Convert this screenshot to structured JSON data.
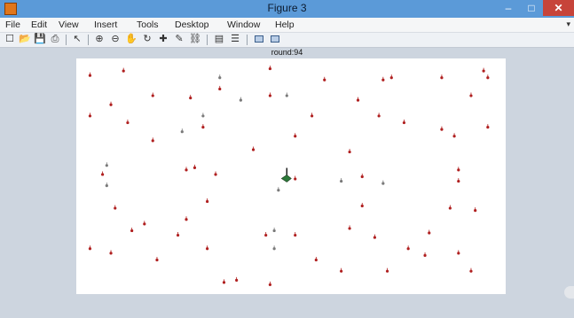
{
  "window": {
    "title": "Figure 3",
    "minimize_glyph": "–",
    "maximize_glyph": "□",
    "close_glyph": "✕"
  },
  "menu": {
    "items": [
      "File",
      "Edit",
      "View",
      "Insert",
      "Tools",
      "Desktop",
      "Window",
      "Help"
    ],
    "overflow_glyph": "▾"
  },
  "toolbar": {
    "buttons": [
      {
        "name": "new-figure-icon",
        "glyph": "☐"
      },
      {
        "name": "open-file-icon",
        "glyph": "📂"
      },
      {
        "name": "save-icon",
        "glyph": "💾"
      },
      {
        "name": "print-icon",
        "glyph": "⎙"
      },
      {
        "name": "pointer-icon",
        "glyph": "↖"
      },
      {
        "name": "zoom-in-icon",
        "glyph": "⊕"
      },
      {
        "name": "zoom-out-icon",
        "glyph": "⊖"
      },
      {
        "name": "pan-icon",
        "glyph": "✋"
      },
      {
        "name": "rotate-3d-icon",
        "glyph": "↻"
      },
      {
        "name": "data-cursor-icon",
        "glyph": "✚"
      },
      {
        "name": "brush-icon",
        "glyph": "✎"
      },
      {
        "name": "link-icon",
        "glyph": "⛓"
      },
      {
        "name": "colorbar-icon",
        "glyph": "▤"
      },
      {
        "name": "legend-icon",
        "glyph": "☰"
      },
      {
        "name": "hide-plot-tools-icon",
        "glyph": "▭"
      },
      {
        "name": "show-plot-tools-icon",
        "glyph": "▣"
      }
    ]
  },
  "plot": {
    "title": "round:94"
  },
  "chart_data": {
    "type": "scatter",
    "title": "round:94",
    "xlim": [
      0,
      100
    ],
    "ylim": [
      0,
      100
    ],
    "grid": false,
    "marker_color_alive": "#b02020",
    "marker_color_dim": "#7a7a7a",
    "base_station_color": "#2c7a3a",
    "base_station": {
      "x": 49,
      "y": 49
    },
    "points": [
      {
        "x": 2,
        "y": 95,
        "dim": false
      },
      {
        "x": 10,
        "y": 97,
        "dim": false
      },
      {
        "x": 33,
        "y": 94,
        "dim": true
      },
      {
        "x": 45,
        "y": 98,
        "dim": false
      },
      {
        "x": 58,
        "y": 93,
        "dim": false
      },
      {
        "x": 72,
        "y": 93,
        "dim": false
      },
      {
        "x": 74,
        "y": 94,
        "dim": false
      },
      {
        "x": 86,
        "y": 94,
        "dim": false
      },
      {
        "x": 96,
        "y": 97,
        "dim": false
      },
      {
        "x": 97,
        "y": 94,
        "dim": false
      },
      {
        "x": 33,
        "y": 89,
        "dim": false
      },
      {
        "x": 7,
        "y": 82,
        "dim": false
      },
      {
        "x": 17,
        "y": 86,
        "dim": false
      },
      {
        "x": 26,
        "y": 85,
        "dim": false
      },
      {
        "x": 38,
        "y": 84,
        "dim": true
      },
      {
        "x": 45,
        "y": 86,
        "dim": false
      },
      {
        "x": 49,
        "y": 86,
        "dim": true
      },
      {
        "x": 66,
        "y": 84,
        "dim": false
      },
      {
        "x": 93,
        "y": 86,
        "dim": false
      },
      {
        "x": 2,
        "y": 77,
        "dim": false
      },
      {
        "x": 11,
        "y": 74,
        "dim": false
      },
      {
        "x": 29,
        "y": 77,
        "dim": true
      },
      {
        "x": 55,
        "y": 77,
        "dim": false
      },
      {
        "x": 71,
        "y": 77,
        "dim": false
      },
      {
        "x": 77,
        "y": 74,
        "dim": false
      },
      {
        "x": 86,
        "y": 71,
        "dim": false
      },
      {
        "x": 89,
        "y": 68,
        "dim": false
      },
      {
        "x": 97,
        "y": 72,
        "dim": false
      },
      {
        "x": 24,
        "y": 70,
        "dim": true
      },
      {
        "x": 29,
        "y": 72,
        "dim": false
      },
      {
        "x": 17,
        "y": 66,
        "dim": false
      },
      {
        "x": 51,
        "y": 68,
        "dim": false
      },
      {
        "x": 41,
        "y": 62,
        "dim": false
      },
      {
        "x": 64,
        "y": 61,
        "dim": false
      },
      {
        "x": 6,
        "y": 55,
        "dim": true
      },
      {
        "x": 5,
        "y": 51,
        "dim": false
      },
      {
        "x": 25,
        "y": 53,
        "dim": false
      },
      {
        "x": 27,
        "y": 54,
        "dim": false
      },
      {
        "x": 32,
        "y": 51,
        "dim": false
      },
      {
        "x": 51,
        "y": 49,
        "dim": false
      },
      {
        "x": 62,
        "y": 48,
        "dim": true
      },
      {
        "x": 67,
        "y": 50,
        "dim": false
      },
      {
        "x": 72,
        "y": 47,
        "dim": true
      },
      {
        "x": 90,
        "y": 53,
        "dim": false
      },
      {
        "x": 90,
        "y": 48,
        "dim": false
      },
      {
        "x": 6,
        "y": 46,
        "dim": true
      },
      {
        "x": 47,
        "y": 44,
        "dim": true
      },
      {
        "x": 30,
        "y": 39,
        "dim": false
      },
      {
        "x": 8,
        "y": 36,
        "dim": false
      },
      {
        "x": 67,
        "y": 37,
        "dim": false
      },
      {
        "x": 88,
        "y": 36,
        "dim": false
      },
      {
        "x": 94,
        "y": 35,
        "dim": false
      },
      {
        "x": 25,
        "y": 31,
        "dim": false
      },
      {
        "x": 15,
        "y": 29,
        "dim": false
      },
      {
        "x": 12,
        "y": 26,
        "dim": false
      },
      {
        "x": 23,
        "y": 24,
        "dim": false
      },
      {
        "x": 44,
        "y": 24,
        "dim": false
      },
      {
        "x": 46,
        "y": 26,
        "dim": true
      },
      {
        "x": 51,
        "y": 24,
        "dim": false
      },
      {
        "x": 64,
        "y": 27,
        "dim": false
      },
      {
        "x": 70,
        "y": 23,
        "dim": false
      },
      {
        "x": 83,
        "y": 25,
        "dim": false
      },
      {
        "x": 2,
        "y": 18,
        "dim": false
      },
      {
        "x": 7,
        "y": 16,
        "dim": false
      },
      {
        "x": 30,
        "y": 18,
        "dim": false
      },
      {
        "x": 46,
        "y": 18,
        "dim": true
      },
      {
        "x": 78,
        "y": 18,
        "dim": false
      },
      {
        "x": 82,
        "y": 15,
        "dim": false
      },
      {
        "x": 90,
        "y": 16,
        "dim": false
      },
      {
        "x": 18,
        "y": 13,
        "dim": false
      },
      {
        "x": 56,
        "y": 13,
        "dim": false
      },
      {
        "x": 62,
        "y": 8,
        "dim": false
      },
      {
        "x": 73,
        "y": 8,
        "dim": false
      },
      {
        "x": 93,
        "y": 8,
        "dim": false
      },
      {
        "x": 34,
        "y": 3,
        "dim": false
      },
      {
        "x": 37,
        "y": 4,
        "dim": false
      },
      {
        "x": 45,
        "y": 2,
        "dim": false
      }
    ]
  }
}
